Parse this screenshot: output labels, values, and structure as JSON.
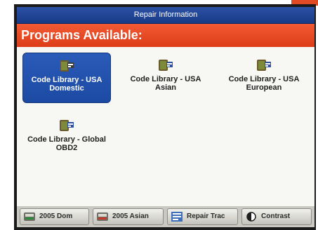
{
  "window": {
    "title": "Repair Information"
  },
  "banner": {
    "heading": "Programs Available:"
  },
  "programs": [
    {
      "label": "Code Library - USA Domestic",
      "selected": true,
      "icon": "code-library-icon"
    },
    {
      "label": "Code Library - USA Asian",
      "selected": false,
      "icon": "code-library-icon"
    },
    {
      "label": "Code Library - USA European",
      "selected": false,
      "icon": "code-library-icon"
    },
    {
      "label": "Code Library - Global OBD2",
      "selected": false,
      "icon": "code-library-icon"
    }
  ],
  "footer": {
    "buttons": [
      {
        "label": "2005 Dom",
        "icon": "vehicle-domestic-icon"
      },
      {
        "label": "2005 Asian",
        "icon": "vehicle-asian-icon"
      },
      {
        "label": "Repair Trac",
        "icon": "repair-trac-icon"
      },
      {
        "label": "Contrast",
        "icon": "contrast-icon"
      }
    ]
  },
  "colors": {
    "titlebar": "#1f469a",
    "banner": "#e8482a",
    "selected": "#2453ae",
    "background": "#f7f7f3",
    "footer": "#c9c9c1"
  }
}
